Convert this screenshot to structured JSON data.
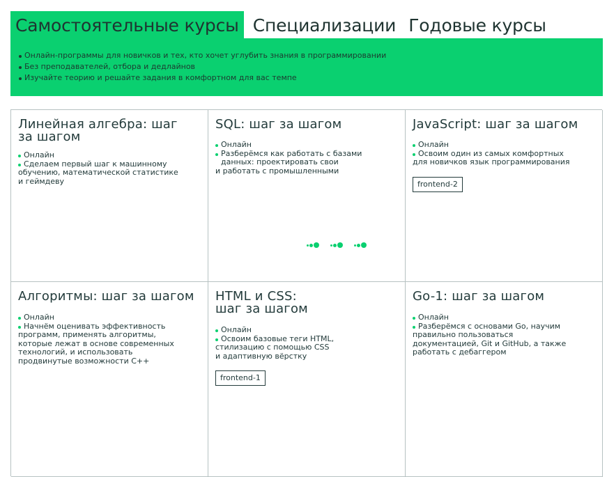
{
  "tabs": [
    {
      "label": "Самостоятельные курсы",
      "active": true
    },
    {
      "label": "Специализации",
      "active": false
    },
    {
      "label": "Годовые курсы",
      "active": false
    }
  ],
  "banner": {
    "items": [
      "Онлайн-программы для новичков и тех, кто хочет углубить знания в программировании",
      "Без преподавателей, отбора и дедлайнов",
      "Изучайте теорию и решайте задания в комфортном для вас темпе"
    ]
  },
  "courses": [
    {
      "title_lines": [
        "Линейная алгебра: шаг",
        "за шагом"
      ],
      "format": "Онлайн",
      "desc_lines": [
        "Сделаем первый шаг к машинному",
        "обучению, математической статистике",
        "и геймдеву"
      ]
    },
    {
      "title_lines": [
        "SQL: шаг за шагом"
      ],
      "format": "Онлайн",
      "desc_lines": [
        "Разберёмся как работать с базами",
        "данных: проектировать свои",
        "и работать с промышленными"
      ]
    },
    {
      "title_lines": [
        "JavaScript: шаг за шагом"
      ],
      "format": "Онлайн",
      "desc_lines": [
        "Освоим один из самых комфортных",
        "для новичков язык программирования"
      ],
      "tag": "frontend-2"
    },
    {
      "title_lines": [
        "Алгоритмы: шаг за шагом"
      ],
      "format": "Онлайн",
      "desc_lines": [
        "Начнём оценивать эффективность",
        "программ, применять алгоритмы,",
        "которые лежат в основе современных",
        "технологий, и использовать",
        "продвинутые возможности C++"
      ]
    },
    {
      "title_lines": [
        "HTML и CSS:",
        "шаг за шагом"
      ],
      "format": "Онлайн",
      "desc_lines": [
        "Освоим базовые теги HTML,",
        "стилизацию с помощью CSS",
        "и адаптивную вёрстку"
      ],
      "tag": "frontend-1"
    },
    {
      "title_lines": [
        "Go-1: шаг за шагом"
      ],
      "format": "Онлайн",
      "desc_lines": [
        "Разберёмся с основами Go, научим",
        "правильно пользоваться",
        "документацией, Git и GitHub, а также",
        "работать с дебаггером"
      ]
    }
  ],
  "colors": {
    "accent": "#0ad070",
    "text": "#233b3b",
    "border": "#b7c2c2"
  },
  "icons": {
    "loader": "loading-dots-icon"
  }
}
